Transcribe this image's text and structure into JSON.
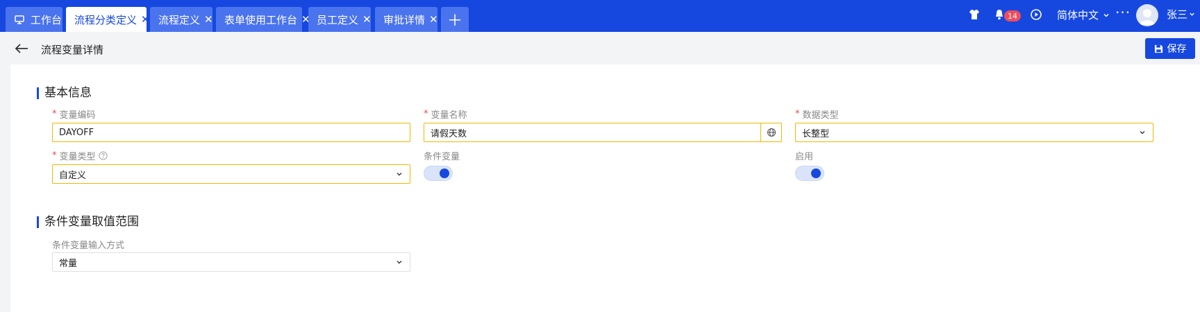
{
  "tabs": [
    {
      "label": "工作台",
      "icon": "monitor-icon"
    },
    {
      "label": "流程分类定义",
      "active": true
    },
    {
      "label": "流程定义"
    },
    {
      "label": "表单使用工作台"
    },
    {
      "label": "员工定义"
    },
    {
      "label": "审批详情"
    }
  ],
  "header": {
    "notification_count": "14",
    "language": "简体中文",
    "more": "···",
    "username": "张三"
  },
  "page": {
    "title": "流程变量详情",
    "save_label": "保存"
  },
  "basic_info": {
    "title": "基本信息",
    "var_code": {
      "label": "变量编码",
      "value": "DAYOFF"
    },
    "var_name": {
      "label": "变量名称",
      "value": "请假天数"
    },
    "data_type": {
      "label": "数据类型",
      "value": "长整型"
    },
    "var_type": {
      "label": "变量类型",
      "value": "自定义"
    },
    "condition_var": {
      "label": "条件变量",
      "enabled": true
    },
    "enable": {
      "label": "启用",
      "enabled": true
    }
  },
  "condition_range": {
    "title": "条件变量取值范围",
    "input_mode": {
      "label": "条件变量输入方式",
      "value": "常量"
    }
  },
  "colors": {
    "brand": "#1648e0",
    "tab_inactive": "#4a73ee",
    "required": "#e5484d",
    "focus_border": "#f0b800",
    "badge": "#f04d5c"
  }
}
